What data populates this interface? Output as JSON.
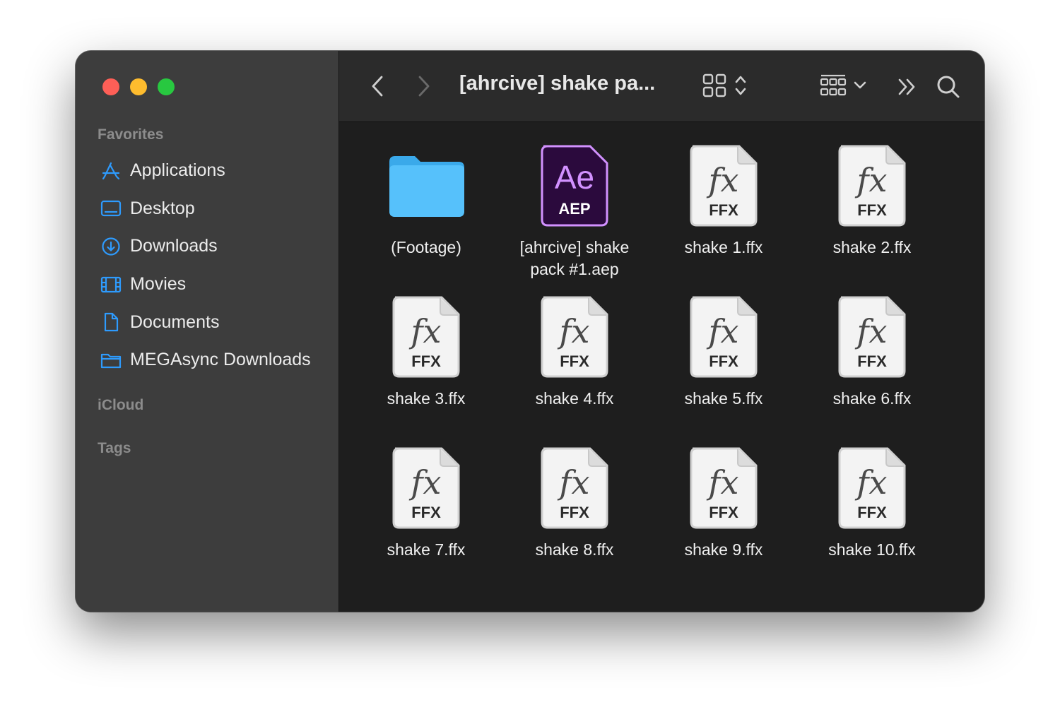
{
  "window": {
    "title": "[ahrcive] shake pa..."
  },
  "sidebar": {
    "favorites_label": "Favorites",
    "items": [
      {
        "label": "Applications",
        "icon": "applications-icon"
      },
      {
        "label": "Desktop",
        "icon": "desktop-icon"
      },
      {
        "label": "Downloads",
        "icon": "downloads-icon"
      },
      {
        "label": "Movies",
        "icon": "movies-icon"
      },
      {
        "label": "Documents",
        "icon": "documents-icon"
      },
      {
        "label": "MEGAsync Downloads",
        "icon": "folder-icon"
      }
    ],
    "icloud_label": "iCloud",
    "tags_label": "Tags"
  },
  "toolbar": {
    "back": "back-icon",
    "forward": "forward-icon",
    "view_mode": "icon-view-icon",
    "group": "group-by-icon",
    "more": "more-icon",
    "search": "search-icon"
  },
  "files": [
    {
      "name": "(Footage)",
      "type": "folder"
    },
    {
      "name": "[ahrcive] shake pack #1.aep",
      "type": "aep",
      "badge_main": "Ae",
      "badge_sub": "AEP"
    },
    {
      "name": "shake 1.ffx",
      "type": "ffx",
      "badge_main": "fx",
      "badge_sub": "FFX"
    },
    {
      "name": "shake 2.ffx",
      "type": "ffx",
      "badge_main": "fx",
      "badge_sub": "FFX"
    },
    {
      "name": "shake 3.ffx",
      "type": "ffx",
      "badge_main": "fx",
      "badge_sub": "FFX"
    },
    {
      "name": "shake 4.ffx",
      "type": "ffx",
      "badge_main": "fx",
      "badge_sub": "FFX"
    },
    {
      "name": "shake 5.ffx",
      "type": "ffx",
      "badge_main": "fx",
      "badge_sub": "FFX"
    },
    {
      "name": "shake 6.ffx",
      "type": "ffx",
      "badge_main": "fx",
      "badge_sub": "FFX"
    },
    {
      "name": "shake 7.ffx",
      "type": "ffx",
      "badge_main": "fx",
      "badge_sub": "FFX"
    },
    {
      "name": "shake 8.ffx",
      "type": "ffx",
      "badge_main": "fx",
      "badge_sub": "FFX"
    },
    {
      "name": "shake 9.ffx",
      "type": "ffx",
      "badge_main": "fx",
      "badge_sub": "FFX"
    },
    {
      "name": "shake 10.ffx",
      "type": "ffx",
      "badge_main": "fx",
      "badge_sub": "FFX"
    }
  ],
  "colors": {
    "accent": "#2e9bfd",
    "folder": "#3fb1f4",
    "ae_purple": "#d291ff",
    "ae_bg": "#2b0a3d"
  }
}
